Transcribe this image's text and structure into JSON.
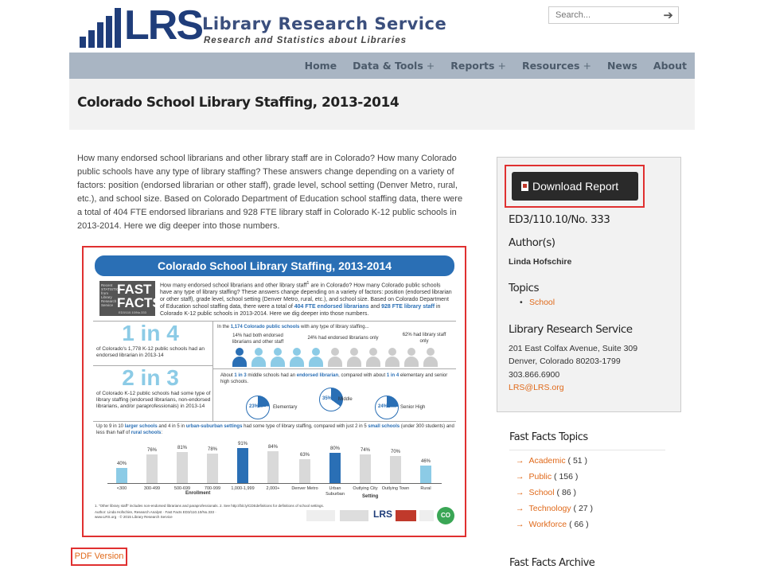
{
  "header": {
    "logo_abbr": "LRS",
    "logo_name": "Library Research Service",
    "logo_tagline": "Research and Statistics about Libraries",
    "search_placeholder": "Search..."
  },
  "nav": {
    "items": [
      {
        "label": "Home",
        "has_sub": false
      },
      {
        "label": "Data & Tools",
        "has_sub": true
      },
      {
        "label": "Reports",
        "has_sub": true
      },
      {
        "label": "Resources",
        "has_sub": true
      },
      {
        "label": "News",
        "has_sub": false
      },
      {
        "label": "About",
        "has_sub": false
      }
    ]
  },
  "page": {
    "title": "Colorado School Library Staffing, 2013-2014",
    "intro": "How many endorsed school librarians and other library staff are in Colorado? How many Colorado public schools have any type of library staffing? These answers change depending on a variety of factors: position (endorsed librarian or other staff), grade level, school setting (Denver Metro, rural, etc.), and school size. Based on Colorado Department of Education school staffing data, there were a total of 404 FTE endorsed librarians and 928 FTE library staff in Colorado K-12 public schools in 2013-2014. Here we dig deeper into those numbers.",
    "pdf_link": "PDF Version"
  },
  "infographic": {
    "title": "Colorado School Library Staffing, 2013-2014",
    "logo_small": "Recent STATISTICS from Library Research Service",
    "logo_big_1": "FAST",
    "logo_big_2": "FACTS",
    "logo_num": "ED3/110.10/No.333",
    "intro_a": "How many endorsed school librarians and other library staff",
    "intro_b": "are in Colorado? How many Colorado public schools have any type of library staffing? These answers change depending on a variety of factors: position (endorsed librarian or other staff), grade level, school setting (Denver Metro, rural, etc.), and school size. Based on Colorado Department of Education school staffing data, there were a total of",
    "intro_hl1": "404 FTE endorsed librarians",
    "intro_and": "and",
    "intro_hl2": "928 FTE library staff",
    "intro_c": "in Colorado K-12 public schools in 2013-2014. Here we dig deeper into those numbers.",
    "stat1": "1 in 4",
    "stat1_desc": "of Colorado's 1,778 K-12 public schools had an endorsed librarian in 2013-14",
    "stat2": "2 in 3",
    "stat2_desc": "of Colorado K-12 public schools had some type of library staffing (endorsed librarians, non-endorsed librarians, and/or paraprofessionals) in 2013-14",
    "people_head_a": "In the",
    "people_head_hl": "1,174 Colorado public schools",
    "people_head_b": "with any type of library staffing...",
    "people_l1": "14% had both endorsed librarians and other staff",
    "people_l2": "24% had endorsed librarians only",
    "people_l3": "62% had library staff only",
    "ratio_a": "About",
    "ratio_hl1": "1 in 3",
    "ratio_b": "middle schools had an",
    "ratio_hl2": "endorsed librarian",
    "ratio_c": ", compared with about",
    "ratio_hl3": "1 in 4",
    "ratio_d": "elementary and senior high schools.",
    "pies": [
      {
        "pct": "23%",
        "label": "Elementary"
      },
      {
        "pct": "35%",
        "label": "Middle"
      },
      {
        "pct": "24%",
        "label": "Senior High"
      }
    ],
    "bar_head_a": "Up to 9 in 10",
    "bar_head_hl1": "larger schools",
    "bar_head_b": "and 4 in 5 in",
    "bar_head_hl2": "urban-suburban settings",
    "bar_head_c": "had some type of library staffing, compared with just 2 in 5",
    "bar_head_hl3": "small schools",
    "bar_head_d": "(under 300 students) and less than half of",
    "bar_head_hl4": "rural schools",
    "bar_head_e": ":",
    "enroll_label": "Enrollment",
    "setting_label": "Setting",
    "footnote": "1. \"Other library staff\" includes non-endorsed librarians and paraprofessionals. 2. See http://bit.ly/CDEdefinitions for definitions of school settings.",
    "credit": "Author: Linda Hofschire, Research Analyst · Fast Facts ED3/110.10/No.333 · www.LRS.org · © 2015 Library Research Service",
    "partner_lrs": "LRS",
    "partner_co": "CO"
  },
  "chart_data": {
    "type": "bar",
    "categories": [
      "<300",
      "300-499",
      "500-699",
      "700-999",
      "1,000-1,999",
      "2,000+",
      "Denver Metro",
      "Urban Suburban",
      "Outlying City",
      "Outlying Town",
      "Rural"
    ],
    "values": [
      40,
      76,
      81,
      78,
      91,
      84,
      63,
      80,
      74,
      70,
      46
    ],
    "ylim": [
      0,
      100
    ],
    "highlighted": [
      "1,000-1,999",
      "Urban Suburban"
    ],
    "colors": {
      "default": "#d9d9d9",
      "highlight": "#2a6fb5",
      "small": "#8ccbe6"
    }
  },
  "sidebar": {
    "download_label": "Download Report",
    "report_number": "ED3/110.10/No. 333",
    "authors_heading": "Author(s)",
    "author": "Linda Hofschire",
    "topics_heading": "Topics",
    "topic": "School",
    "org_heading": "Library Research Service",
    "address1": "201 East Colfax Avenue, Suite 309",
    "address2": "Denver, Colorado 80203-1799",
    "phone": "303.866.6900",
    "email": "LRS@LRS.org"
  },
  "fast_facts": {
    "topics_heading": "Fast Facts Topics",
    "topics": [
      {
        "name": "Academic",
        "count": "( 51 )"
      },
      {
        "name": "Public",
        "count": "( 156 )"
      },
      {
        "name": "School",
        "count": "( 86 )"
      },
      {
        "name": "Technology",
        "count": "( 27 )"
      },
      {
        "name": "Workforce",
        "count": "( 66 )"
      }
    ],
    "archive_heading": "Fast Facts Archive"
  },
  "colors": {
    "brand_navy": "#1f3d7a",
    "nav_bg": "#a9b5c3",
    "link_orange": "#e06a1b",
    "highlight_red": "#e03030",
    "infographic_blue": "#2a6fb5"
  }
}
